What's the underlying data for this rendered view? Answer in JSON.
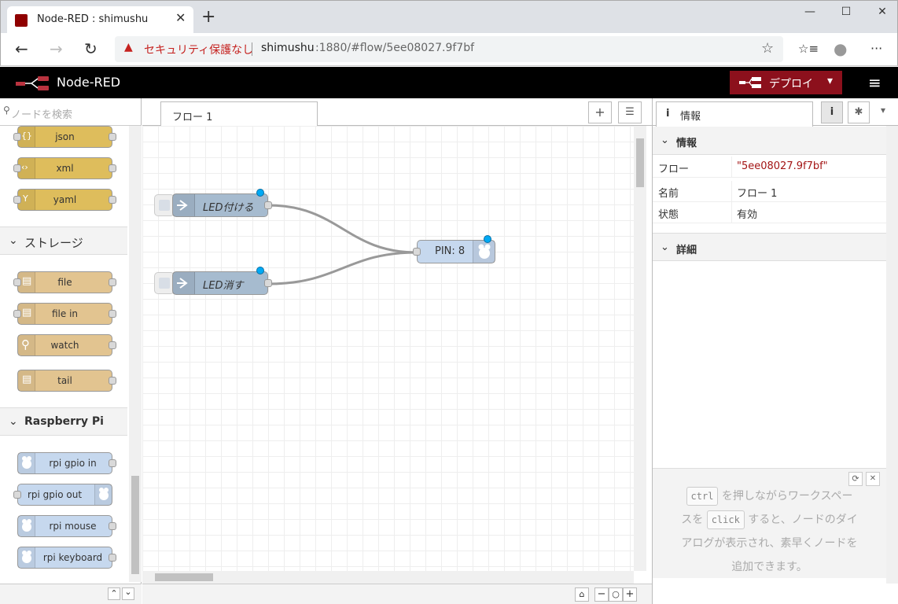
{
  "browser": {
    "tab_title": "Node-RED : shimushu",
    "close_tab": "✕",
    "new_tab": "+",
    "window": {
      "minimize": "—",
      "maximize": "☐",
      "close": "✕"
    },
    "back": "←",
    "forward": "→",
    "reload": "↻",
    "security_icon": "▲",
    "security_text": "セキュリティ保護なし",
    "url_host": "shimushu",
    "url_rest": ":1880/#flow/5ee08027.9f7bf",
    "favorite_icon": "☆",
    "collections_icon": "☆≡",
    "profile_icon": "●",
    "more_icon": "···"
  },
  "header": {
    "title": "Node-RED",
    "deploy_label": "デプロイ",
    "deploy_caret": "▾",
    "menu_icon": "≡"
  },
  "palette": {
    "search_placeholder": "ノードを検索",
    "search_icon": "⚲",
    "parser_nodes": [
      {
        "label": "json",
        "icon": "{}"
      },
      {
        "label": "xml",
        "icon": "‹›"
      },
      {
        "label": "yaml",
        "icon": "Y"
      }
    ],
    "storage_category": "ストレージ",
    "storage_nodes": [
      {
        "label": "file",
        "icon": "▤"
      },
      {
        "label": "file in",
        "icon": "▤"
      },
      {
        "label": "watch",
        "icon": "⚲"
      },
      {
        "label": "tail",
        "icon": "▤"
      }
    ],
    "rpi_category": "Raspberry Pi",
    "rpi_nodes": [
      {
        "label": "rpi gpio in"
      },
      {
        "label": "rpi gpio out"
      },
      {
        "label": "rpi mouse"
      },
      {
        "label": "rpi keyboard"
      }
    ],
    "chevron": "⌄",
    "collapse_up": "⌃",
    "collapse_down": "⌄"
  },
  "workspace": {
    "tab_label": "フロー 1",
    "add_flow": "+",
    "list_flows": "☰",
    "nodes": [
      {
        "label": "LED付ける",
        "type": "inject"
      },
      {
        "label": "LED消す",
        "type": "inject"
      },
      {
        "label": "PIN: 8",
        "type": "rpi-gpio-out"
      }
    ],
    "zoom_map": "⌂",
    "zoom_out": "−",
    "zoom_reset": "○",
    "zoom_in": "+"
  },
  "sidebar": {
    "tab_label": "情報",
    "info_icon": "i",
    "debug_icon": "✱",
    "dropdown_icon": "▾",
    "info_section": "情報",
    "rows": [
      {
        "key": "フロー",
        "value": "\"5ee08027.9f7bf\""
      },
      {
        "key": "名前",
        "value": "フロー 1"
      },
      {
        "key": "状態",
        "value": "有効"
      }
    ],
    "details_section": "詳細",
    "tip": {
      "kbd1": "ctrl",
      "part1": "を押しながらワークスペー",
      "part2": "スを",
      "kbd2": "click",
      "part3": "すると、ノードのダイ",
      "part4": "アログが表示され、素早くノードを",
      "part5": "追加できます。"
    },
    "refresh_icon": "⟳",
    "close_icon": "✕"
  },
  "colors": {
    "parser": "#debd5c",
    "storage": "#e2c490",
    "rpi": "#c6d8ee",
    "inject": "#a6bbcf",
    "deploy": "#8c101c"
  }
}
